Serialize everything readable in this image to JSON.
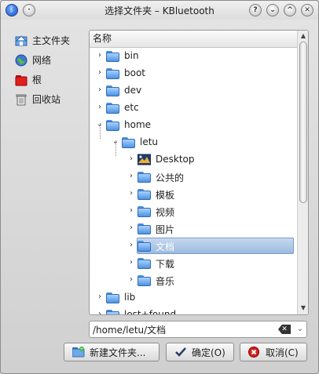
{
  "window": {
    "title": "选择文件夹 – KBluetooth",
    "buttons": [
      "?",
      "⌄",
      "^",
      "✕"
    ]
  },
  "sidebar": {
    "items": [
      {
        "label": "主文件夹",
        "icon": "home-icon"
      },
      {
        "label": "网络",
        "icon": "globe-icon"
      },
      {
        "label": "根",
        "icon": "red-folder-icon"
      },
      {
        "label": "回收站",
        "icon": "trash-icon"
      }
    ]
  },
  "tree": {
    "header": "名称",
    "rows": [
      {
        "label": "bin",
        "depth": 0,
        "arrow": "›"
      },
      {
        "label": "boot",
        "depth": 0,
        "arrow": "›"
      },
      {
        "label": "dev",
        "depth": 0,
        "arrow": "›"
      },
      {
        "label": "etc",
        "depth": 0,
        "arrow": "›"
      },
      {
        "label": "home",
        "depth": 0,
        "arrow": "⌄"
      },
      {
        "label": "letu",
        "depth": 1,
        "arrow": "⌄"
      },
      {
        "label": "Desktop",
        "depth": 2,
        "arrow": "›"
      },
      {
        "label": "公共的",
        "depth": 2,
        "arrow": "›"
      },
      {
        "label": "模板",
        "depth": 2,
        "arrow": "›"
      },
      {
        "label": "视频",
        "depth": 2,
        "arrow": "›"
      },
      {
        "label": "图片",
        "depth": 2,
        "arrow": "›"
      },
      {
        "label": "文档",
        "depth": 2,
        "arrow": "›",
        "selected": true
      },
      {
        "label": "下载",
        "depth": 2,
        "arrow": "›"
      },
      {
        "label": "音乐",
        "depth": 2,
        "arrow": "›"
      },
      {
        "label": "lib",
        "depth": 0,
        "arrow": "›"
      },
      {
        "label": "lost+found",
        "depth": 0,
        "arrow": "›"
      }
    ]
  },
  "path": {
    "value": "/home/letu/文档"
  },
  "buttons": {
    "new_folder": "新建文件夹...",
    "ok": "确定(O)",
    "cancel": "取消(C)"
  },
  "colors": {
    "folder": "#4f93e0",
    "selection": "#9cbbe0"
  }
}
